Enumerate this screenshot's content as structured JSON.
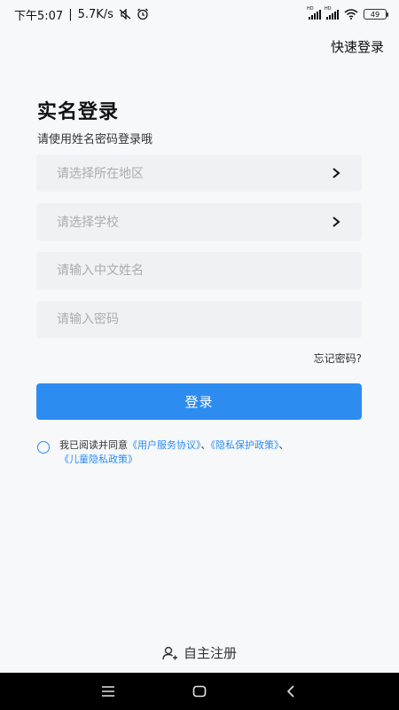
{
  "status_bar": {
    "time": "下午5:07",
    "speed": "5.7K/s",
    "battery": "49",
    "hd_label": "HD"
  },
  "header": {
    "quick_login": "快速登录"
  },
  "main": {
    "title": "实名登录",
    "subtitle": "请使用姓名密码登录哦",
    "region_placeholder": "请选择所在地区",
    "school_placeholder": "请选择学校",
    "name_placeholder": "请输入中文姓名",
    "password_placeholder": "请输入密码",
    "forgot_password": "忘记密码?",
    "login_button": "登录"
  },
  "agreement": {
    "prefix": "我已阅读并同意",
    "user_agreement": "《用户服务协议》",
    "sep1": "、",
    "privacy_policy": "《隐私保护政策》",
    "sep2": "、",
    "child_privacy": "《儿童隐私政策》"
  },
  "footer": {
    "register": "自主注册"
  },
  "colors": {
    "accent": "#2d8cf0",
    "background": "#f7f8fa",
    "field_bg": "#eff1f4"
  }
}
